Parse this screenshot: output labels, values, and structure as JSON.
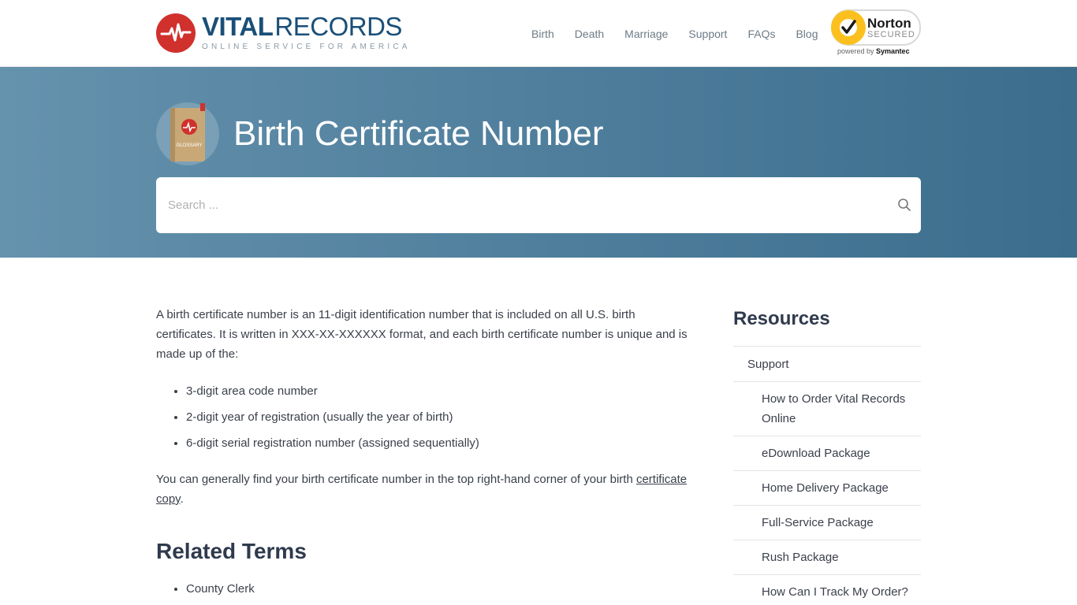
{
  "header": {
    "logo": {
      "title_bold": "VITAL",
      "title_light": "RECORDS",
      "tagline": "ONLINE SERVICE FOR AMERICA",
      "icon": "heartbeat-icon"
    },
    "nav": [
      "Birth",
      "Death",
      "Marriage",
      "Support",
      "FAQs",
      "Blog"
    ],
    "norton": {
      "name": "Norton",
      "secured": "SECURED",
      "powered_by": "powered by",
      "brand": "Symantec",
      "icon": "checkmark-icon"
    }
  },
  "hero": {
    "title": "Birth Certificate Number",
    "icon": "glossary-book-icon",
    "icon_label": "GLOSSARY",
    "search": {
      "placeholder": "Search ...",
      "value": "",
      "icon": "search-icon"
    }
  },
  "article": {
    "intro": "A birth certificate number is an 11-digit identification number that is included on all U.S. birth certificates. It is written in XXX-XX-XXXXXX format, and each birth certificate number is unique and is made up of the:",
    "bullets": [
      "3-digit area code number",
      "2-digit year of registration (usually the year of birth)",
      "6-digit serial registration number (assigned sequentially)"
    ],
    "outro_before": "You can generally find your birth certificate number in the top right-hand corner of your birth ",
    "outro_link": "certificate copy",
    "outro_after": ".",
    "related_title": "Related Terms",
    "related": [
      "County Clerk"
    ]
  },
  "sidebar": {
    "title": "Resources",
    "items": [
      {
        "label": "Support",
        "level": 1
      },
      {
        "label": "How to Order Vital Records Online",
        "level": 2
      },
      {
        "label": "eDownload Package",
        "level": 2
      },
      {
        "label": "Home Delivery Package",
        "level": 2
      },
      {
        "label": "Full-Service Package",
        "level": 2
      },
      {
        "label": "Rush Package",
        "level": 2
      },
      {
        "label": "How Can I Track My Order?",
        "level": 2
      }
    ]
  },
  "colors": {
    "brand_blue": "#1a4f78",
    "brand_red": "#d0312d",
    "hero_start": "#6592ad",
    "hero_end": "#3c6d8c",
    "norton_yellow": "#fcc01e"
  }
}
